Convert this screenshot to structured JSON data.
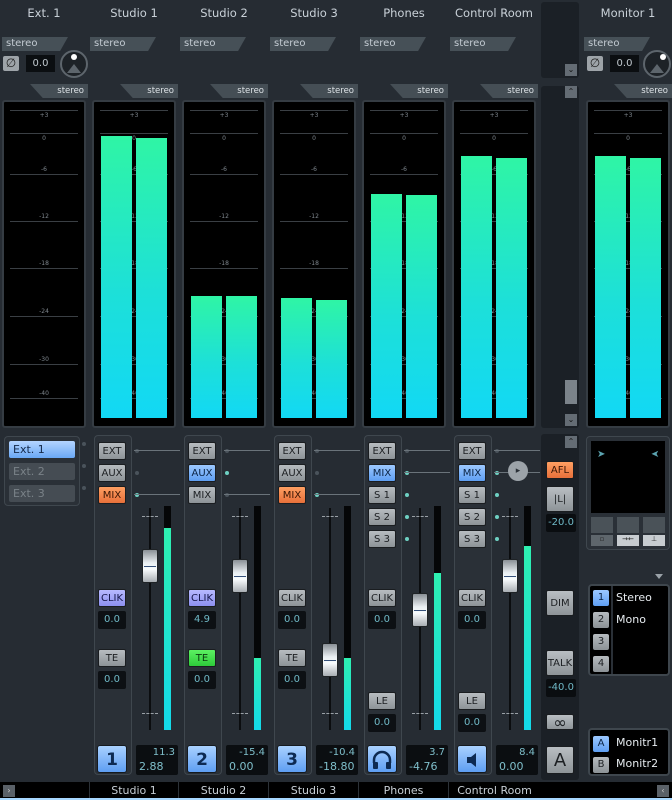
{
  "channels": [
    {
      "name": "Ext. 1",
      "input_format": "stereo",
      "meter_format": "stereo",
      "phase_value": "0.0",
      "meter_levels_db": [
        null,
        null
      ]
    },
    {
      "name": "Studio 1",
      "input_format": "stereo",
      "meter_format": "stereo",
      "meter_levels_db": [
        -0.5,
        -0.8
      ]
    },
    {
      "name": "Studio 2",
      "input_format": "stereo",
      "meter_format": "stereo",
      "meter_levels_db": [
        -21.5,
        -21.5
      ]
    },
    {
      "name": "Studio 3",
      "input_format": "stereo",
      "meter_format": "stereo",
      "meter_levels_db": [
        -21.7,
        -22.0
      ]
    },
    {
      "name": "Phones",
      "input_format": "stereo",
      "meter_format": "stereo",
      "meter_levels_db": [
        -8.5,
        -8.7
      ]
    },
    {
      "name": "Control Room",
      "input_format": "stereo",
      "meter_format": "stereo",
      "meter_levels_db": [
        -3.4,
        -3.6
      ]
    },
    {
      "name": "Monitor 1",
      "input_format": "stereo",
      "meter_format": "stereo",
      "phase_value": "0.0",
      "meter_levels_db": [
        -3.4,
        -3.6
      ]
    }
  ],
  "meter_scale": [
    "+3",
    "0",
    "-6",
    "-12",
    "-18",
    "-24",
    "-30",
    "-40"
  ],
  "ext_inputs": [
    "Ext. 1",
    "Ext. 2",
    "Ext. 3"
  ],
  "strips": [
    {
      "id": "studio1",
      "number": "1",
      "sources": [
        "EXT",
        "AUX",
        "MIX"
      ],
      "active_source": "MIX",
      "clik": "CLIK",
      "clik_active": true,
      "clik_val": "0.0",
      "te": "TE",
      "te_active": false,
      "te_val": "0.0",
      "level_top": "11.3",
      "level_bottom": "2.88",
      "fader": 0.78,
      "meter": 0.9,
      "footer": "Studio 1"
    },
    {
      "id": "studio2",
      "number": "2",
      "sources": [
        "EXT",
        "AUX",
        "MIX"
      ],
      "active_source": "AUX",
      "clik": "CLIK",
      "clik_active": true,
      "clik_val": "4.9",
      "te": "TE",
      "te_active": true,
      "te_val": "0.0",
      "level_top": "-15.4",
      "level_bottom": "0.00",
      "fader": 0.73,
      "meter": 0.32,
      "footer": "Studio 2"
    },
    {
      "id": "studio3",
      "number": "3",
      "sources": [
        "EXT",
        "AUX",
        "MIX"
      ],
      "active_source": "MIX",
      "clik": "CLIK",
      "clik_active": false,
      "clik_val": "0.0",
      "te": "TE",
      "te_active": false,
      "te_val": "0.0",
      "level_top": "-10.4",
      "level_bottom": "-18.80",
      "fader": 0.28,
      "meter": 0.32,
      "footer": "Studio 3"
    },
    {
      "id": "phones",
      "icon": "headphones",
      "sources": [
        "EXT",
        "MIX",
        "S 1",
        "S 2",
        "S 3"
      ],
      "active_source": "MIX",
      "clik": "CLIK",
      "clik_active": false,
      "clik_val": "0.0",
      "le": "LE",
      "le_val": "0.0",
      "level_top": "3.7",
      "level_bottom": "-4.76",
      "fader": 0.55,
      "meter": 0.7,
      "footer": "Phones"
    },
    {
      "id": "control_room",
      "icon": "speaker",
      "sources": [
        "EXT",
        "MIX",
        "S 1",
        "S 2",
        "S 3"
      ],
      "active_source": "MIX",
      "clik": "CLIK",
      "clik_active": false,
      "clik_val": "0.0",
      "le": "LE",
      "le_val": "0.0",
      "level_top": "8.4",
      "level_bottom": "0.00",
      "fader": 0.73,
      "meter": 0.82,
      "footer": "Control Room"
    }
  ],
  "control_room_side": {
    "afl": "AFL",
    "mono_label": "|L|",
    "afl_level": "-20.0",
    "dim": "DIM",
    "talk": "TALK",
    "talk_level": "-40.0",
    "ref_label": "A"
  },
  "downmix": {
    "items": [
      {
        "num": "1",
        "label": "Stereo",
        "active": true
      },
      {
        "num": "2",
        "label": "Mono",
        "active": false
      },
      {
        "num": "3",
        "label": "",
        "active": false
      },
      {
        "num": "4",
        "label": "",
        "active": false
      }
    ]
  },
  "monitors": {
    "items": [
      {
        "num": "A",
        "label": "Monitr1",
        "active": true
      },
      {
        "num": "B",
        "label": "Monitr2",
        "active": false
      }
    ]
  },
  "footer": {
    "names": [
      "Studio 1",
      "Studio 2",
      "Studio 3",
      "Phones",
      "Control Room"
    ]
  }
}
